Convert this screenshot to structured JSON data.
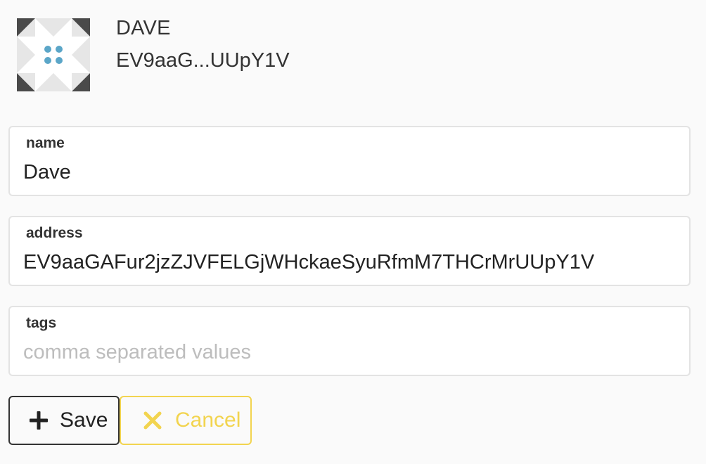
{
  "contact": {
    "name": "DAVE",
    "short_address": "EV9aaG...UUpY1V"
  },
  "form": {
    "name": {
      "label": "name",
      "value": "Dave"
    },
    "address": {
      "label": "address",
      "value": "EV9aaGAFur2jzZJVFELGjWHckaeSyuRfmM7THCrMrUUpY1V"
    },
    "tags": {
      "label": "tags",
      "value": "",
      "placeholder": "comma separated values"
    }
  },
  "actions": {
    "save_label": "Save",
    "cancel_label": "Cancel",
    "save_icon": "plus-icon",
    "cancel_icon": "x-icon"
  },
  "colors": {
    "avatar_dark": "#4a4a4a",
    "avatar_light": "#e6e6e6",
    "avatar_accent": "#5ba6c8",
    "cancel_accent": "#f2d44f"
  }
}
